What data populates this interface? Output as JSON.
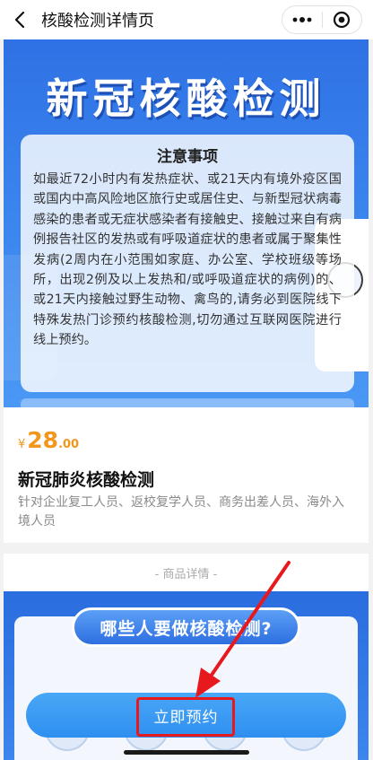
{
  "navbar": {
    "back_icon": "chevron-left-icon",
    "title": "核酸检测详情页",
    "more_icon": "more-dots-icon",
    "close_icon": "target-circle-icon"
  },
  "banner": {
    "title": "新冠核酸检测",
    "notice_title": "注意事项",
    "notice_body": "如最近72小时内有发热症状、或21天内有境外疫区国或国内中高风险地区旅行史或居住史、与新型冠状病毒感染的患者或无症状感染者有接触史、接触过来自有病例报告社区的发热或有呼吸道症状的患者或属于聚集性发病(2周内在小范围如家庭、办公室、学校班级等场所，出现2例及以上发热和/或呼吸道症状的病例)的、或21天内接触过野生动物、禽鸟的,请务必到医院线下特殊发热门诊预约核酸检测,切勿通过互联网医院进行线上预约。"
  },
  "product": {
    "price_symbol": "¥",
    "price_integer": "28",
    "price_decimal": ".00",
    "name": "新冠肺炎核酸检测",
    "description": "针对企业复工人员、返校复学人员、商务出差人员、海外入境人员"
  },
  "details": {
    "divider_label": "- 商品详情 -",
    "image_heading": "哪些人要做核酸检测?"
  },
  "footer": {
    "book_label": "立即预约"
  },
  "colors": {
    "accent_blue": "#2e8ff0",
    "price_orange": "#f3961c",
    "annotation_red": "#e8191c"
  }
}
